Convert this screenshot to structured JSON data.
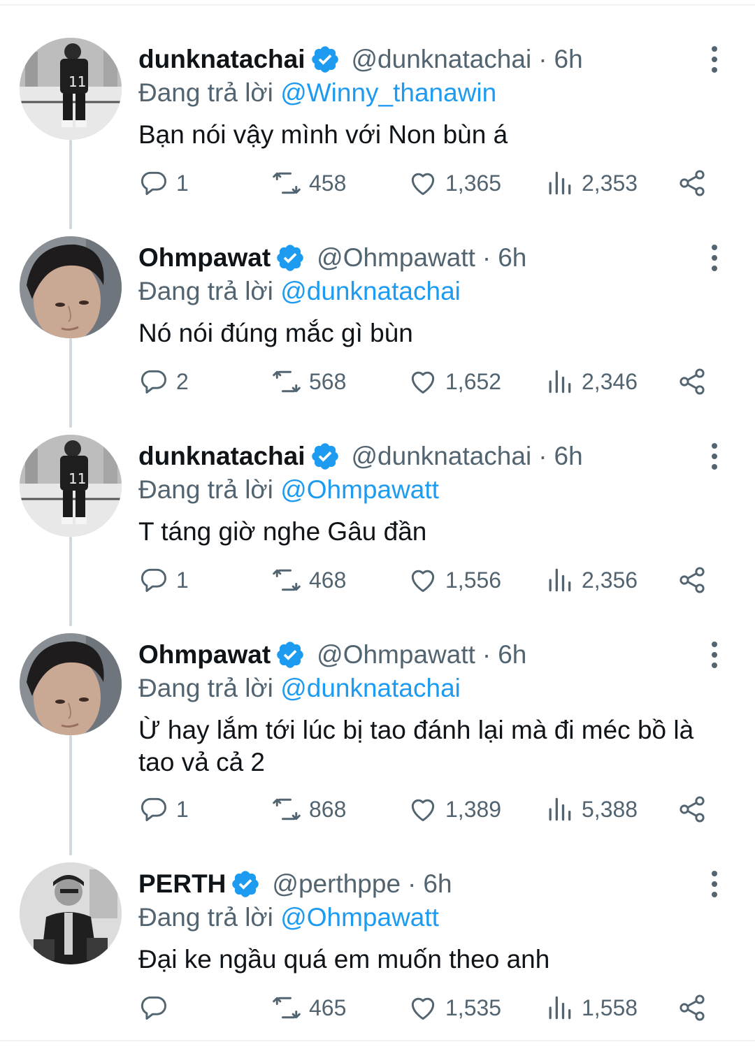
{
  "reply_prefix": "Đang trả lời",
  "dot": "·",
  "tweets": [
    {
      "name": "dunknatachai",
      "handle": "@dunknatachai",
      "time": "6h",
      "reply_to": "@Winny_thanawin",
      "text": "Bạn nói vậy mình với Non bùn á",
      "replies": "1",
      "retweets": "458",
      "likes": "1,365",
      "views": "2,353",
      "avatar": "player-avatar"
    },
    {
      "name": "Ohmpawat",
      "handle": "@Ohmpawatt",
      "time": "6h",
      "reply_to": "@dunknatachai",
      "text": "Nó nói đúng mắc gì bùn",
      "replies": "2",
      "retweets": "568",
      "likes": "1,652",
      "views": "2,346",
      "avatar": "portrait-avatar"
    },
    {
      "name": "dunknatachai",
      "handle": "@dunknatachai",
      "time": "6h",
      "reply_to": "@Ohmpawatt",
      "text": "T táng giờ nghe Gâu đần",
      "replies": "1",
      "retweets": "468",
      "likes": "1,556",
      "views": "2,356",
      "avatar": "player-avatar"
    },
    {
      "name": "Ohmpawat",
      "handle": "@Ohmpawatt",
      "time": "6h",
      "reply_to": "@dunknatachai",
      "text": "Ừ hay lắm tới lúc bị tao đánh lại mà đi méc bồ là tao vả cả 2",
      "replies": "1",
      "retweets": "868",
      "likes": "1,389",
      "views": "5,388",
      "avatar": "portrait-avatar"
    },
    {
      "name": "PERTH",
      "handle": "@perthppe",
      "time": "6h",
      "reply_to": "@Ohmpawatt",
      "text": "Đại ke ngầu quá em muốn theo anh",
      "replies": "",
      "retweets": "465",
      "likes": "1,535",
      "views": "1,558",
      "avatar": "bw-photo-avatar"
    }
  ],
  "colors": {
    "accent": "#1d9bf0",
    "secondary_text": "#536471",
    "thread_line": "#cfd9de"
  },
  "icons": [
    "verified-badge-icon",
    "more-options-icon",
    "reply-icon",
    "retweet-icon",
    "like-icon",
    "views-icon",
    "share-icon"
  ]
}
